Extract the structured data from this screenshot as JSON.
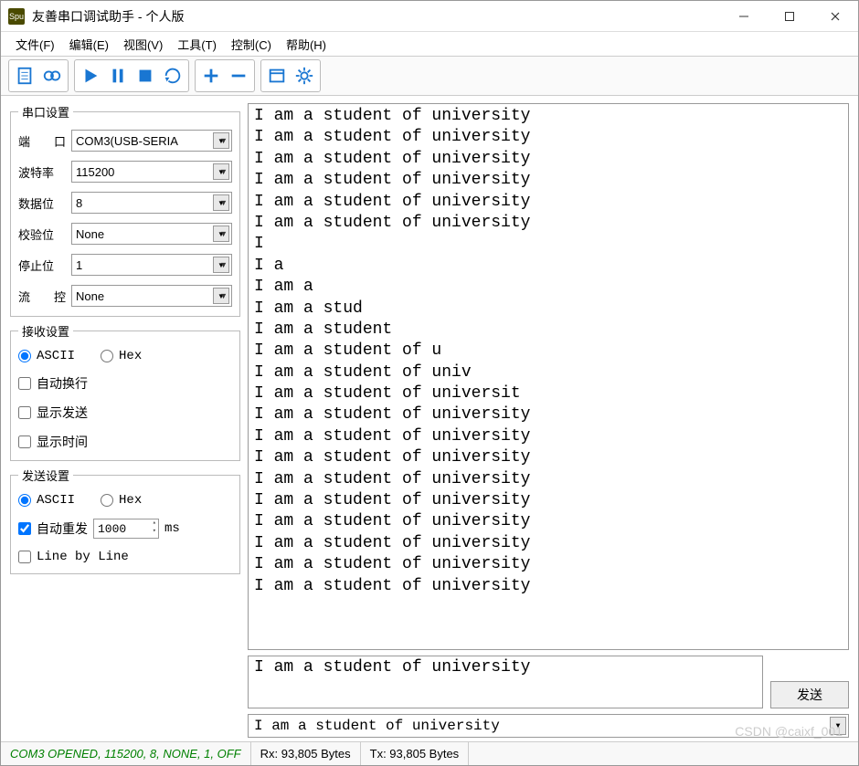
{
  "window": {
    "title": "友善串口调试助手 - 个人版",
    "icon_text": "Spu"
  },
  "menu": {
    "file": "文件(F)",
    "edit": "编辑(E)",
    "view": "视图(V)",
    "tools": "工具(T)",
    "control": "控制(C)",
    "help": "帮助(H)"
  },
  "serial": {
    "legend": "串口设置",
    "port_label": "端　　口",
    "port_value": "COM3(USB-SERIA",
    "baud_label": "波特率",
    "baud_value": "115200",
    "databits_label": "数据位",
    "databits_value": "8",
    "parity_label": "校验位",
    "parity_value": "None",
    "stopbits_label": "停止位",
    "stopbits_value": "1",
    "flow_label": "流　　控",
    "flow_value": "None"
  },
  "recv": {
    "legend": "接收设置",
    "ascii": "ASCII",
    "hex": "Hex",
    "autowrap": "自动换行",
    "showsend": "显示发送",
    "showtime": "显示时间"
  },
  "send": {
    "legend": "发送设置",
    "ascii": "ASCII",
    "hex": "Hex",
    "autoresend": "自动重发",
    "interval": "1000",
    "unit": "ms",
    "linebyline": "Line by Line"
  },
  "output_lines": [
    "I am a student of university",
    "I am a student of university",
    "I am a student of university",
    "I am a student of university",
    "I am a student of university",
    "I am a student of university",
    "I",
    "I a",
    "I am a",
    "I am a stud",
    "I am a student",
    "I am a student of u",
    "I am a student of univ",
    "I am a student of universit",
    "I am a student of university",
    "I am a student of university",
    "I am a student of university",
    "I am a student of university",
    "I am a student of university",
    "I am a student of university",
    "I am a student of university",
    "I am a student of university",
    "I am a student of university"
  ],
  "input_text": "I am a student of university",
  "send_button": "发送",
  "history_text": "I am a student of university",
  "status": {
    "connection": "COM3 OPENED, 115200, 8, NONE, 1, OFF",
    "rx": "Rx: 93,805 Bytes",
    "tx": "Tx: 93,805 Bytes"
  },
  "watermark": "CSDN @caixf_001"
}
